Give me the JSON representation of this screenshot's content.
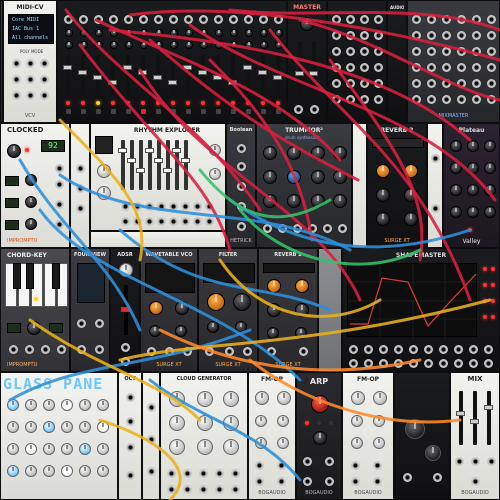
{
  "rack": {
    "row1": [
      {
        "id": "blank-left",
        "title": "",
        "theme": "dark"
      },
      {
        "id": "midi-cv",
        "title": "MIDI-CV",
        "screen_lines": [
          "Core MIDI",
          "IAC Bus 1",
          "All channels"
        ],
        "sub_label": "POLY MODE",
        "brand": "VCV",
        "theme": "light"
      },
      {
        "id": "mixer",
        "title": "",
        "theme": "black"
      },
      {
        "id": "mixer-master",
        "title": "MASTER",
        "theme": "black"
      },
      {
        "id": "audio",
        "title": "",
        "theme": "black"
      },
      {
        "id": "audio-right",
        "title": "AUDIO",
        "theme": "black"
      },
      {
        "id": "mixer-right",
        "title": "",
        "brand": "MIXMASTER",
        "theme": "dark"
      }
    ],
    "row2": [
      {
        "id": "clocked",
        "title": "CLOCKED",
        "display": "92",
        "brand": "IMPROMPTU",
        "theme": "light"
      },
      {
        "id": "rhythm-explorer",
        "title": "RHYTHM EXPLORER",
        "theme": "light"
      },
      {
        "id": "boolean",
        "title": "Boolean",
        "brand": "HETRICK",
        "theme": "dark"
      },
      {
        "id": "rummor",
        "title": "TRUMMOR²",
        "subtitle": "drum synthesizer",
        "theme": "dark"
      },
      {
        "id": "blank-white",
        "title": "",
        "theme": "light"
      },
      {
        "id": "reverb2-a",
        "title": "REVERB 2",
        "brand": "SURGE XT",
        "theme": "black"
      },
      {
        "id": "plateau",
        "title": "Plateau",
        "brand": "Valley",
        "theme": "dark"
      }
    ],
    "row3": [
      {
        "id": "chord-key",
        "title": "CHORD-KEY",
        "brand": "IMPROMPTU",
        "theme": "dark"
      },
      {
        "id": "four-view",
        "title": "FOUR-VIEW",
        "theme": "dark"
      },
      {
        "id": "adsr",
        "title": "ADSR",
        "theme": "black"
      },
      {
        "id": "wavetable-vco",
        "title": "WAVETABLE VCO",
        "brand": "SURGE XT",
        "theme": "dark"
      },
      {
        "id": "filter",
        "title": "FILTER",
        "brand": "SURGE XT",
        "theme": "dark"
      },
      {
        "id": "reverb2-b",
        "title": "REVERB 2",
        "brand": "SURGE XT",
        "theme": "dark"
      },
      {
        "id": "blank-grey",
        "title": "",
        "theme": "grey"
      },
      {
        "id": "shapemaster",
        "title": "SHAPEMASTER",
        "theme": "black"
      }
    ],
    "row4": [
      {
        "id": "glass-pane",
        "title": "GLASS PANE",
        "theme": "light"
      },
      {
        "id": "oct",
        "title": "OCT",
        "theme": "light"
      },
      {
        "id": "cloud-generator",
        "title": "CLOUD GENERATOR",
        "theme": "light"
      },
      {
        "id": "fm-op-a",
        "title": "FM-OP",
        "brand": "BOGAUDIO",
        "theme": "light"
      },
      {
        "id": "arp",
        "title": "ARP",
        "brand": "BOGAUDIO",
        "theme": "black"
      },
      {
        "id": "fm-op-b",
        "title": "FM-OP",
        "brand": "BOGAUDIO",
        "theme": "light"
      },
      {
        "id": "blank-black",
        "title": "",
        "theme": "black"
      },
      {
        "id": "mix",
        "title": "MIX",
        "brand": "BOGAUDIO",
        "theme": "light"
      }
    ]
  },
  "colors": {
    "cable_red": "#d81f3f",
    "cable_blue": "#2d8fd8",
    "cable_yellow": "#e8b21d",
    "cable_green": "#34c06b",
    "cable_orange": "#ff8a2a"
  }
}
